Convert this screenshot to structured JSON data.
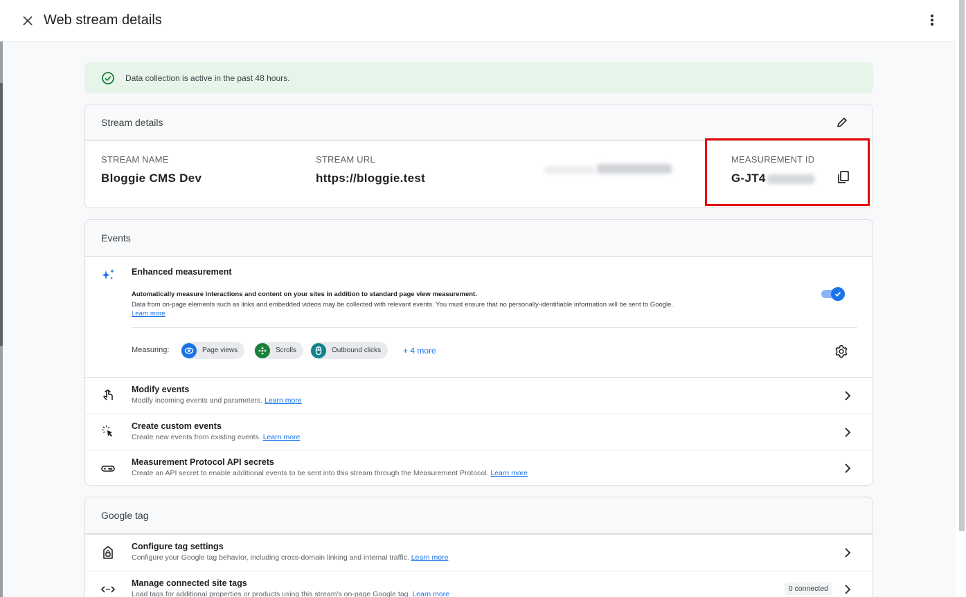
{
  "header": {
    "title": "Web stream details",
    "close_icon": "close-icon",
    "menu_icon": "more-vert-icon"
  },
  "banner": {
    "text": "Data collection is active in the past 48 hours.",
    "icon": "check-circle-icon",
    "color": "#188038"
  },
  "stream_details": {
    "heading": "Stream details",
    "edit_icon": "pencil-icon",
    "stream_name_label": "STREAM NAME",
    "stream_name": "Bloggie CMS Dev",
    "stream_url_label": "STREAM URL",
    "stream_url": "https://bloggie.test",
    "measurement_id_label": "MEASUREMENT ID",
    "measurement_id_prefix": "G-JT4",
    "copy_icon": "copy-icon",
    "highlight_color": "#e60000"
  },
  "events": {
    "heading": "Events",
    "enhanced": {
      "title": "Enhanced measurement",
      "desc1": "Automatically measure interactions and content on your sites in addition to standard page view measurement.",
      "desc2": "Data from on-page elements such as links and embedded videos may be collected with relevant events. You must ensure that no personally-identifiable information will be sent to Google.",
      "learn_more": "Learn more",
      "toggle_on": true,
      "measuring_label": "Measuring:",
      "chips": [
        {
          "label": "Page views",
          "icon": "eye-icon",
          "color": "#1a73e8"
        },
        {
          "label": "Scrolls",
          "icon": "scroll-icon",
          "color": "#188038"
        },
        {
          "label": "Outbound clicks",
          "icon": "mouse-icon",
          "color": "#12828c"
        }
      ],
      "more": "+ 4 more",
      "settings_icon": "gear-icon"
    },
    "rows": [
      {
        "title": "Modify events",
        "desc": "Modify incoming events and parameters.",
        "link": "Learn more",
        "icon": "touch-icon"
      },
      {
        "title": "Create custom events",
        "desc": "Create new events from existing events.",
        "link": "Learn more",
        "icon": "cursor-click-icon"
      },
      {
        "title": "Measurement Protocol API secrets",
        "desc": "Create an API secret to enable additional events to be sent into this stream through the Measurement Protocol.",
        "link": "Learn more",
        "icon": "key-icon"
      }
    ]
  },
  "google_tag": {
    "heading": "Google tag",
    "rows": [
      {
        "title": "Configure tag settings",
        "desc": "Configure your Google tag behavior, including cross-domain linking and internal traffic.",
        "link": "Learn more",
        "icon": "tag-icon"
      },
      {
        "title": "Manage connected site tags",
        "desc": "Load tags for additional properties or products using this stream's on-page Google tag.",
        "link": "Learn more",
        "icon": "code-icon",
        "badge": "0 connected"
      }
    ]
  }
}
